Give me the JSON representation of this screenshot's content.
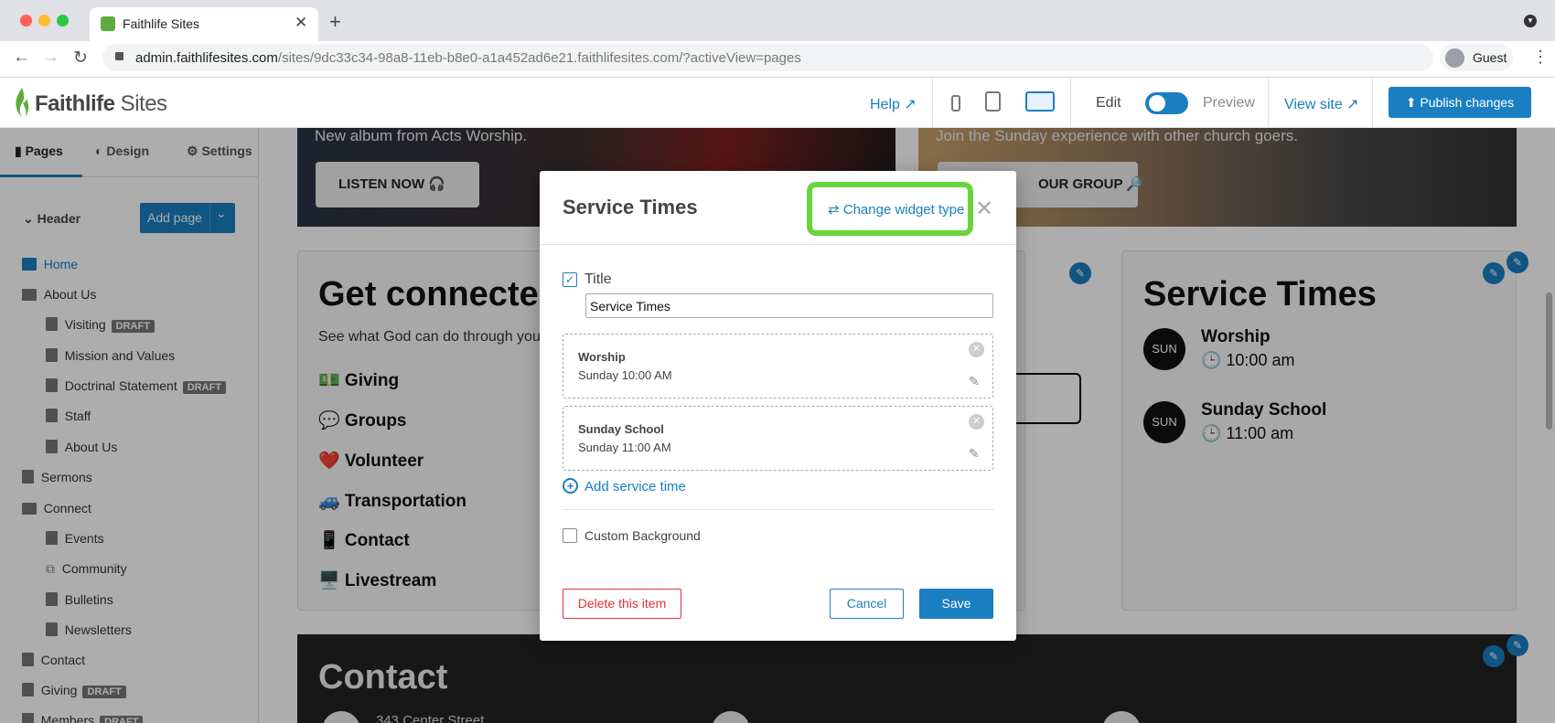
{
  "browser": {
    "tab_title": "Faithlife Sites",
    "tab_close": "✕",
    "new_tab": "+",
    "url_host": "admin.faithlifesites.com",
    "url_path": "/sites/9dc33c34-98a8-11eb-b8e0-a1a452ad6e21.faithlifesites.com/?activeView=pages",
    "profile_label": "Guest",
    "colors": {
      "close": "#ff5f57",
      "min": "#febc2e",
      "max": "#28c840"
    }
  },
  "app": {
    "logo_brand": "Faithlife",
    "logo_product": " Sites",
    "help": "Help ↗",
    "edit": "Edit",
    "preview": "Preview",
    "view_site": "View site ↗",
    "publish": "⬆ Publish changes",
    "accent": "#1a7fc1"
  },
  "sidebar": {
    "tabs": {
      "pages": "Pages",
      "design": "Design",
      "settings": "Settings"
    },
    "header_label": "Header",
    "add_page": "Add page",
    "draft_badge": "DRAFT",
    "items": [
      {
        "label": "Home",
        "icon": "home-icon"
      },
      {
        "label": "About Us",
        "icon": "folder-icon"
      },
      {
        "label": "Visiting",
        "icon": "page-icon",
        "draft": true
      },
      {
        "label": "Mission and Values",
        "icon": "page-icon"
      },
      {
        "label": "Doctrinal Statement",
        "icon": "page-icon",
        "draft": true
      },
      {
        "label": "Staff",
        "icon": "page-icon"
      },
      {
        "label": "About Us",
        "icon": "page-icon"
      },
      {
        "label": "Sermons",
        "icon": "page-icon"
      },
      {
        "label": "Connect",
        "icon": "folder-icon"
      },
      {
        "label": "Events",
        "icon": "page-icon"
      },
      {
        "label": "Community",
        "icon": "external-link-icon"
      },
      {
        "label": "Bulletins",
        "icon": "page-icon"
      },
      {
        "label": "Newsletters",
        "icon": "page-icon"
      },
      {
        "label": "Contact",
        "icon": "page-icon"
      },
      {
        "label": "Giving",
        "icon": "page-icon",
        "draft": true
      },
      {
        "label": "Members",
        "icon": "page-icon",
        "draft": true
      }
    ]
  },
  "canvas": {
    "hero1_sub": "New album from Acts Worship.",
    "hero1_btn": "LISTEN NOW 🎧",
    "hero2_sub": "Join the Sunday experience with other church goers.",
    "hero2_btn": "OUR GROUP 🔎",
    "connect_title": "Get connected",
    "connect_sub": "See what God can do through you",
    "connect_links": [
      "💵 Giving",
      "💬 Groups",
      "❤️ Volunteer",
      "🚙 Transportation",
      "📱 Contact",
      "🖥️ Livestream"
    ],
    "st_title": "Service Times",
    "services": [
      {
        "day": "SUN",
        "name": "Worship",
        "time": "🕒 10:00 am"
      },
      {
        "day": "SUN",
        "name": "Sunday School",
        "time": "🕒 11:00 am"
      }
    ],
    "contact_title": "Contact",
    "contact_addr": "343 Center Street",
    "edit_icon": "✎"
  },
  "modal": {
    "title": "Service Times",
    "change_widget": "⇄ Change widget type",
    "close": "✕",
    "title_label": "Title",
    "title_checked": true,
    "title_value": "Service Times",
    "services": [
      {
        "name": "Worship",
        "time": "Sunday 10:00 AM"
      },
      {
        "name": "Sunday School",
        "time": "Sunday 11:00 AM"
      }
    ],
    "add_service": "Add service time",
    "custom_bg": "Custom Background",
    "custom_bg_checked": false,
    "delete": "Delete this item",
    "cancel": "Cancel",
    "save": "Save",
    "highlight_color": "#6ad43f"
  }
}
